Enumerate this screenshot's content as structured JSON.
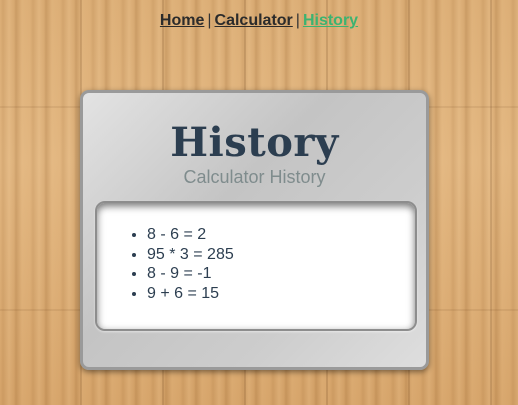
{
  "nav": {
    "items": [
      {
        "label": "Home",
        "active": false
      },
      {
        "label": "Calculator",
        "active": false
      },
      {
        "label": "History",
        "active": true
      }
    ],
    "separator": "|"
  },
  "panel": {
    "title": "History",
    "subtitle": "Calculator History"
  },
  "history": {
    "entries": [
      "8 - 6 = 2",
      "95 * 3 = 285",
      "8 - 9 = -1",
      "9 + 6 = 15"
    ]
  },
  "colors": {
    "active_link": "#3cb371",
    "title": "#2c3e50",
    "subtitle": "#7f8c8d"
  }
}
